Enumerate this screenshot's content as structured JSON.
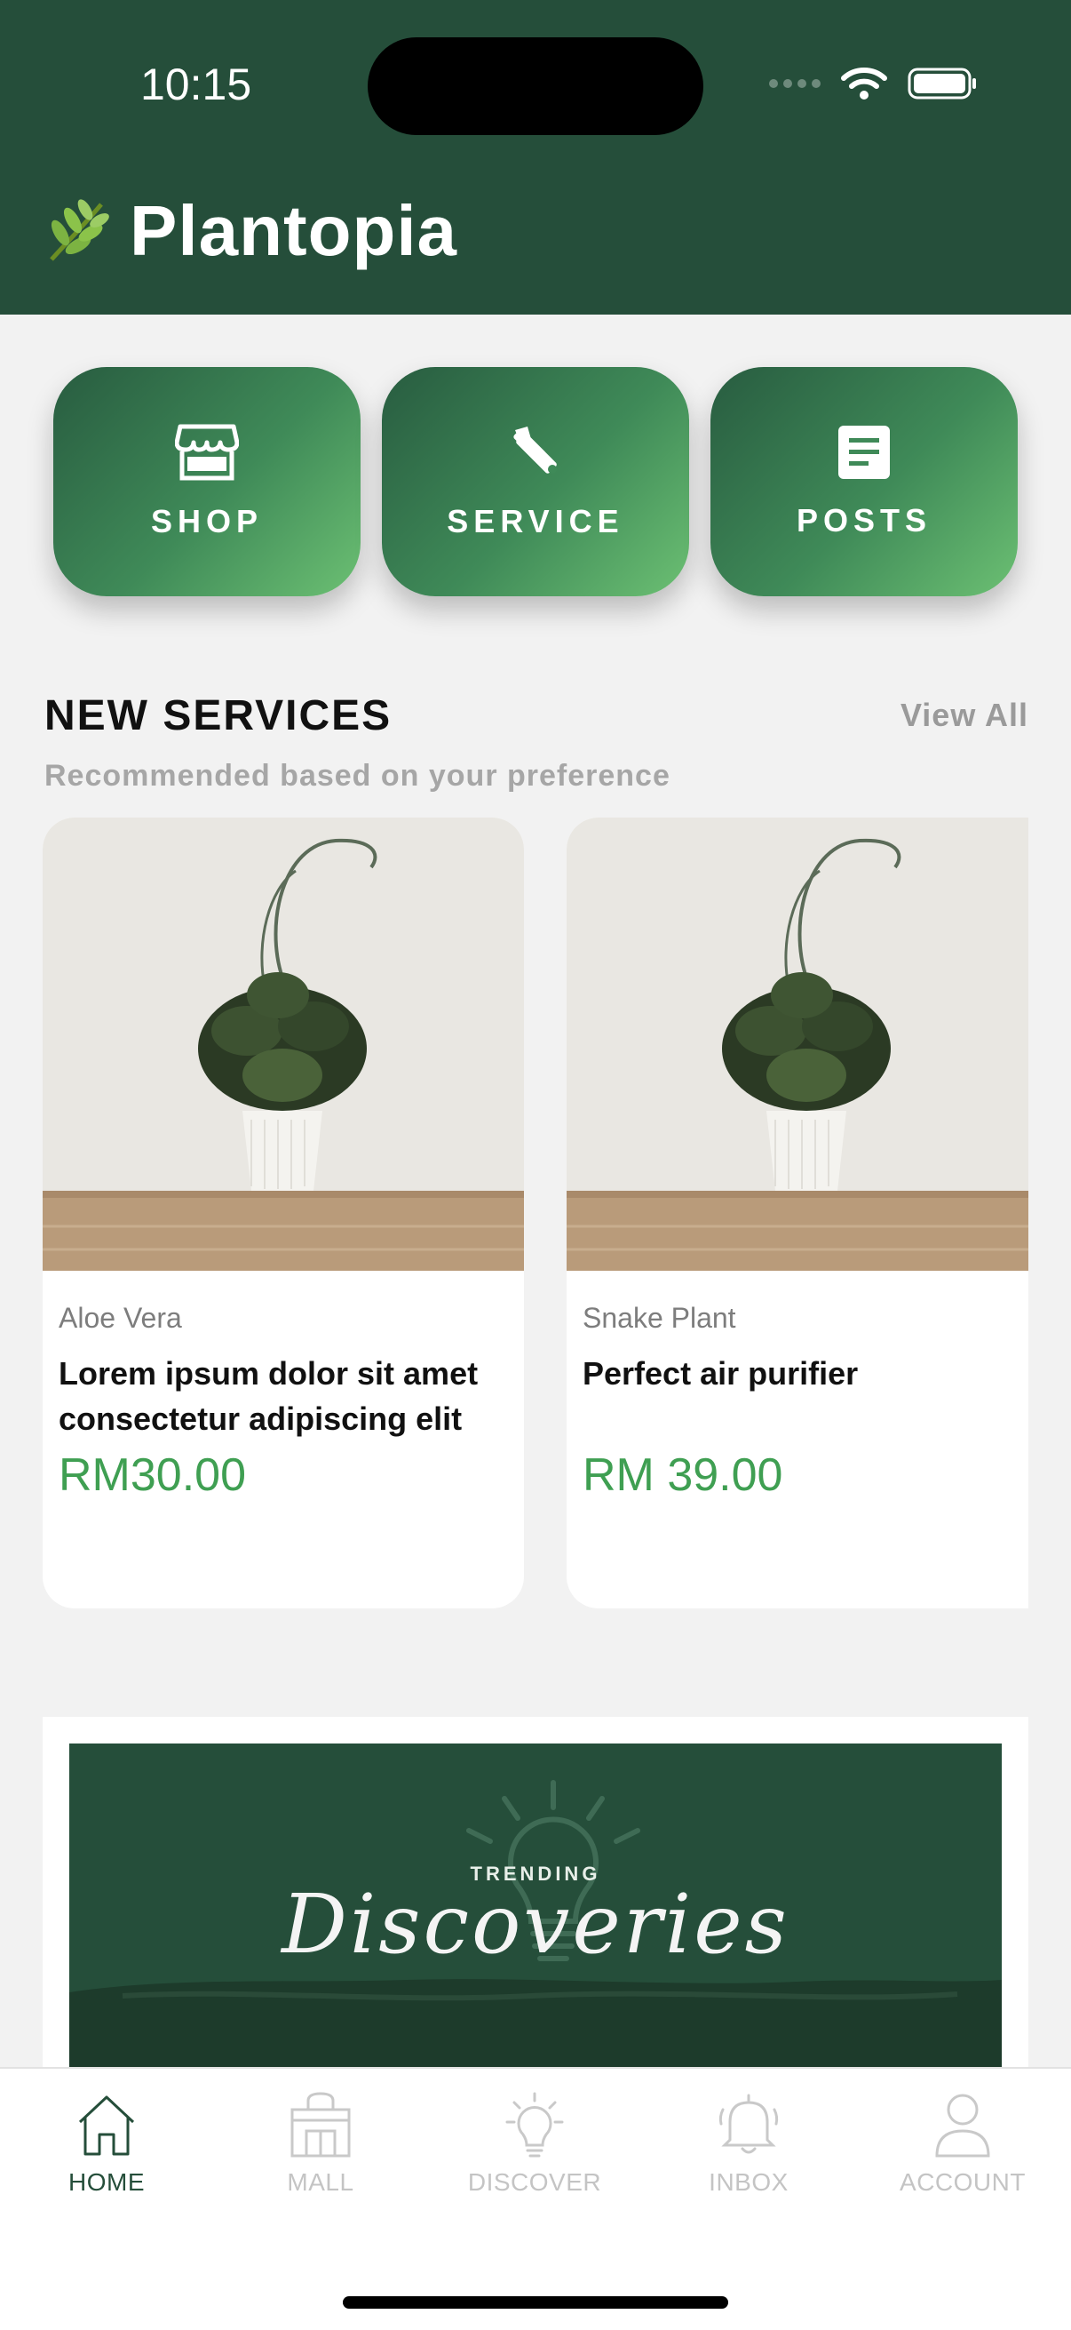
{
  "status_bar": {
    "time": "10:15"
  },
  "header": {
    "app_title": "Plantopia",
    "logo_icon": "leaf-sprig-icon"
  },
  "categories": [
    {
      "label": "SHOP",
      "icon": "storefront-icon"
    },
    {
      "label": "SERVICE",
      "icon": "tools-icon"
    },
    {
      "label": "POSTS",
      "icon": "document-icon"
    }
  ],
  "new_services": {
    "title": "NEW SERVICES",
    "view_all": "View All",
    "subtitle": "Recommended based on your preference",
    "items": [
      {
        "category": "Aloe Vera",
        "title": "Lorem ipsum dolor sit amet consectetur adipiscing elit",
        "price": "RM30.00"
      },
      {
        "category": "Snake Plant",
        "title": "Perfect air purifier",
        "price": "RM 39.00"
      }
    ]
  },
  "banner": {
    "tag": "TRENDING",
    "script_title": "Discoveries"
  },
  "bottom_nav": {
    "items": [
      {
        "label": "HOME",
        "icon": "home-icon",
        "active": true
      },
      {
        "label": "MALL",
        "icon": "mall-icon",
        "active": false
      },
      {
        "label": "DISCOVER",
        "icon": "lightbulb-icon",
        "active": false
      },
      {
        "label": "INBOX",
        "icon": "bell-icon",
        "active": false
      },
      {
        "label": "ACCOUNT",
        "icon": "user-icon",
        "active": false
      }
    ]
  },
  "colors": {
    "header_bg": "#254e3a",
    "accent_green": "#3f9f52",
    "page_bg": "#f2f2f2"
  }
}
